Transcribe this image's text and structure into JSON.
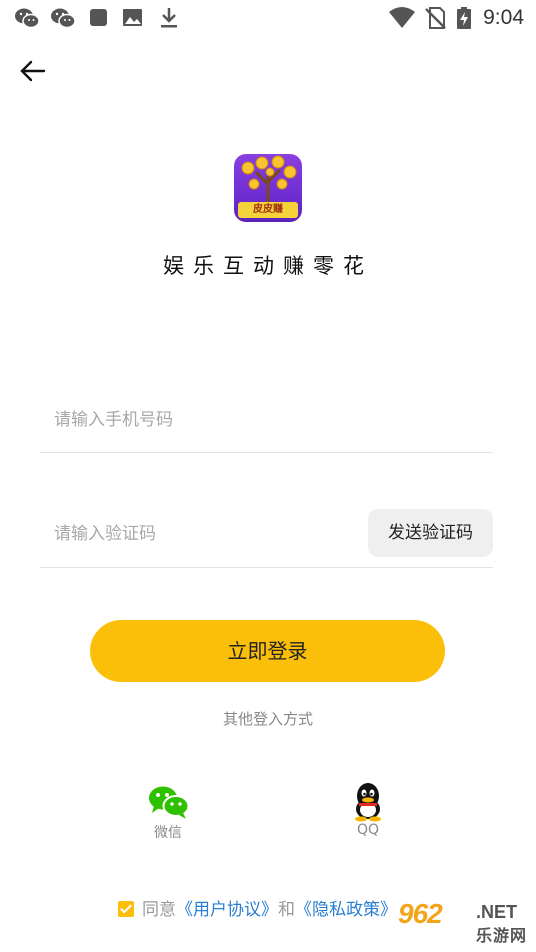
{
  "status_bar": {
    "time": "9:04",
    "left_icons": [
      "wechat-icon",
      "wechat-icon",
      "stop-icon",
      "image-icon",
      "download-icon"
    ],
    "right_icons": [
      "wifi-icon",
      "no-sim-icon",
      "battery-charging-icon"
    ]
  },
  "header": {
    "back_icon": "arrow-left-icon"
  },
  "app": {
    "logo_text": "皮皮赚",
    "tagline": "娱乐互动赚零花"
  },
  "form": {
    "phone_placeholder": "请输入手机号码",
    "phone_value": "",
    "code_placeholder": "请输入验证码",
    "code_value": "",
    "send_code_label": "发送验证码",
    "login_label": "立即登录"
  },
  "other_login": {
    "title": "其他登入方式",
    "options": [
      {
        "label": "微信",
        "icon": "wechat-icon"
      },
      {
        "label": "QQ",
        "icon": "qq-icon"
      }
    ]
  },
  "agreement": {
    "checked": true,
    "prefix": "同意",
    "user_agreement": "《用户协议》",
    "and": "和",
    "privacy_policy": "《隐私政策》"
  },
  "watermark": {
    "main": "962",
    "net": ".NET",
    "sub": "乐游网"
  },
  "colors": {
    "accent": "#fbbf09",
    "link": "#2a7ed0",
    "wechat": "#2dc100"
  }
}
